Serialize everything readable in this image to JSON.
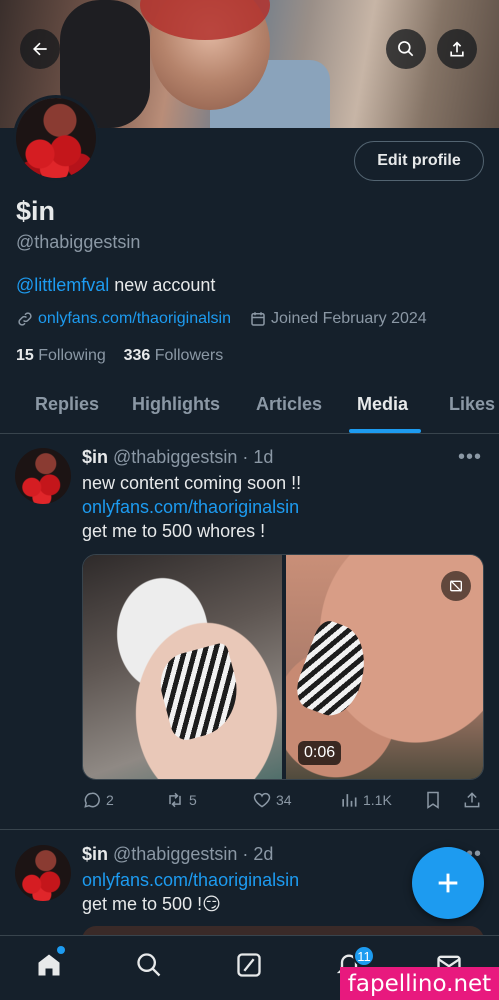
{
  "profile": {
    "name": "$in",
    "handle": "@thabiggestsin",
    "bio_mention": "@littlemfval",
    "bio_text": " new account",
    "link": "onlyfans.com/thaoriginalsin",
    "joined": "Joined February 2024",
    "following_count": "15",
    "following_label": " Following",
    "followers_count": "336",
    "followers_label": " Followers",
    "edit_label": "Edit profile"
  },
  "tabs": [
    "Replies",
    "Highlights",
    "Articles",
    "Media",
    "Likes"
  ],
  "active_tab": "Media",
  "posts": [
    {
      "name": "$in",
      "meta": " @thabiggestsin · 1d",
      "line1": "new content coming soon !!",
      "link": "onlyfans.com/thaoriginalsin",
      "line2": "get me to 500 whores !",
      "video_duration": "0:06",
      "replies": "2",
      "reposts": "5",
      "likes": "34",
      "views": "1.1K"
    },
    {
      "name": "$in",
      "meta": " @thabiggestsin · 2d",
      "link": "onlyfans.com/thaoriginalsin",
      "line1": "get me to 500 !😏"
    }
  ],
  "nav": {
    "notifications_badge": "11"
  },
  "watermark": "fapellino.net",
  "colors": {
    "accent": "#1d9bf0",
    "background": "#15202b",
    "muted": "#8b98a5",
    "watermark": "#e8197e"
  }
}
